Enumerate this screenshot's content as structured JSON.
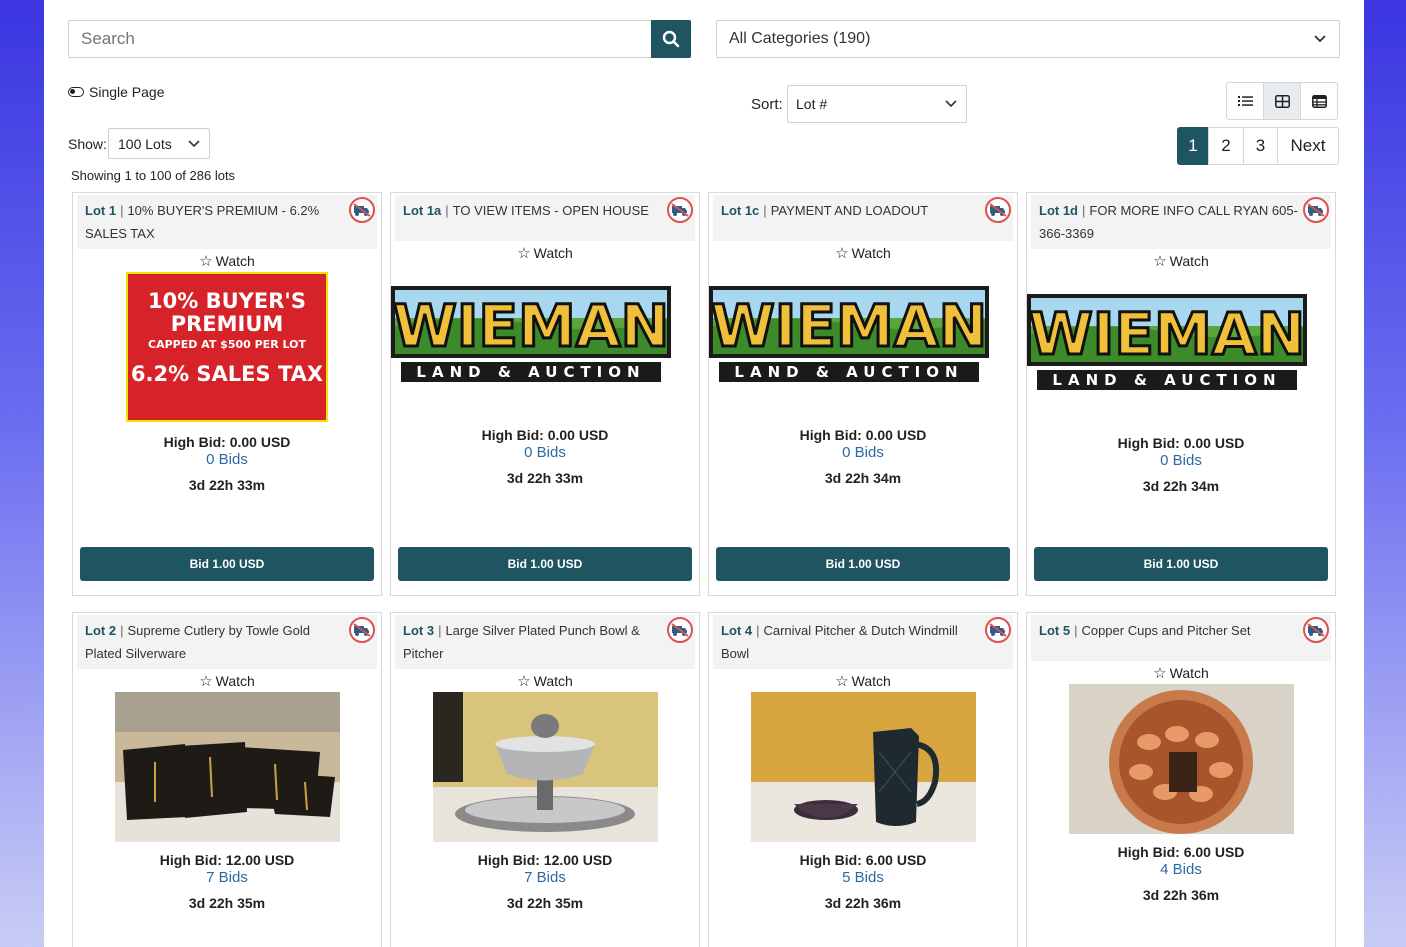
{
  "search": {
    "placeholder": "Search"
  },
  "category": {
    "selected": "All Categories (190)"
  },
  "single_page_label": "Single Page",
  "sort": {
    "label": "Sort:",
    "selected": "Lot #"
  },
  "show": {
    "label": "Show:",
    "selected": "100 Lots"
  },
  "pagination": {
    "pages": [
      "1",
      "2",
      "3"
    ],
    "next": "Next",
    "active": "1"
  },
  "showing_text": "Showing 1 to 100 of 286 lots",
  "view_modes": [
    "list-view-icon",
    "grid-view-icon",
    "table-view-icon"
  ],
  "watch_label": "Watch",
  "colors": {
    "primary": "#1f5560",
    "link": "#2c6aa3",
    "no_ship": "#d9534f"
  },
  "premium_banner": {
    "line1": "10% BUYER'S PREMIUM",
    "line2": "CAPPED AT $500 PER LOT",
    "line3": "6.2% SALES TAX"
  },
  "logo_text": {
    "brand": "WIEMAN",
    "sub": "LAND & AUCTION"
  },
  "lots": [
    {
      "lot": "Lot 1",
      "title": "10% BUYER'S PREMIUM - 6.2% SALES TAX",
      "high_bid": "High Bid: 0.00 USD",
      "bids": "0 Bids",
      "time": "3d 22h 33m",
      "bid_btn": "Bid 1.00 USD",
      "image": "premium-banner"
    },
    {
      "lot": "Lot 1a",
      "title": "TO VIEW ITEMS - OPEN HOUSE",
      "high_bid": "High Bid: 0.00 USD",
      "bids": "0 Bids",
      "time": "3d 22h 33m",
      "bid_btn": "Bid 1.00 USD",
      "image": "logo"
    },
    {
      "lot": "Lot 1c",
      "title": "PAYMENT AND LOADOUT",
      "high_bid": "High Bid: 0.00 USD",
      "bids": "0 Bids",
      "time": "3d 22h 34m",
      "bid_btn": "Bid 1.00 USD",
      "image": "logo"
    },
    {
      "lot": "Lot 1d",
      "title": "FOR MORE INFO CALL RYAN 605-366-3369",
      "high_bid": "High Bid: 0.00 USD",
      "bids": "0 Bids",
      "time": "3d 22h 34m",
      "bid_btn": "Bid 1.00 USD",
      "image": "logo"
    },
    {
      "lot": "Lot 2",
      "title": "Supreme Cutlery by Towle Gold Plated Silverware",
      "high_bid": "High Bid: 12.00 USD",
      "bids": "7 Bids",
      "time": "3d 22h 35m",
      "image": "photo-silverware"
    },
    {
      "lot": "Lot 3",
      "title": "Large Silver Plated Punch Bowl & Pitcher",
      "high_bid": "High Bid: 12.00 USD",
      "bids": "7 Bids",
      "time": "3d 22h 35m",
      "image": "photo-punch-bowl"
    },
    {
      "lot": "Lot 4",
      "title": "Carnival Pitcher & Dutch Windmill Bowl",
      "high_bid": "High Bid: 6.00 USD",
      "bids": "5 Bids",
      "time": "3d 22h 36m",
      "image": "photo-carnival-pitcher"
    },
    {
      "lot": "Lot 5",
      "title": "Copper Cups and Pitcher Set",
      "high_bid": "High Bid: 6.00 USD",
      "bids": "4 Bids",
      "time": "3d 22h 36m",
      "image": "photo-copper-cups"
    }
  ]
}
